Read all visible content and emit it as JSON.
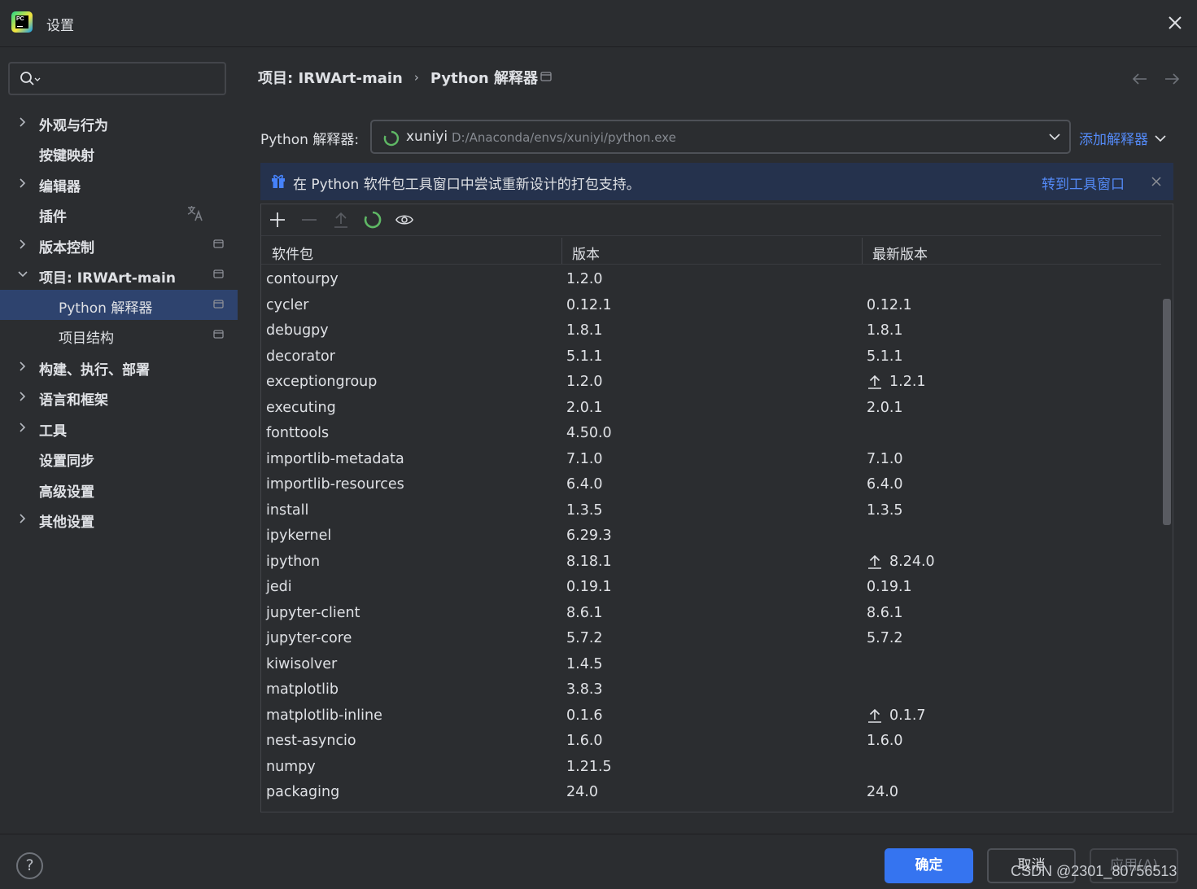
{
  "window": {
    "title": "设置"
  },
  "search": {
    "placeholder": ""
  },
  "sidebar": {
    "items": [
      {
        "label": "外观与行为"
      },
      {
        "label": "按键映射"
      },
      {
        "label": "编辑器"
      },
      {
        "label": "插件"
      },
      {
        "label": "版本控制"
      },
      {
        "label": "项目: IRWArt-main"
      },
      {
        "label": "Python 解释器"
      },
      {
        "label": "项目结构"
      },
      {
        "label": "构建、执行、部署"
      },
      {
        "label": "语言和框架"
      },
      {
        "label": "工具"
      },
      {
        "label": "设置同步"
      },
      {
        "label": "高级设置"
      },
      {
        "label": "其他设置"
      }
    ]
  },
  "breadcrumb": {
    "project": "项目: IRWArt-main",
    "page": "Python 解释器"
  },
  "interpreter": {
    "label": "Python 解释器:",
    "name": "xuniyi",
    "path": "D:/Anaconda/envs/xuniyi/python.exe",
    "add_label": "添加解释器"
  },
  "banner": {
    "message": "在 Python 软件包工具窗口中尝试重新设计的打包支持。",
    "link": "转到工具窗口"
  },
  "table": {
    "headers": [
      "软件包",
      "版本",
      "最新版本"
    ],
    "rows": [
      {
        "name": "contourpy",
        "version": "1.2.0",
        "latest": "",
        "upgrade": false
      },
      {
        "name": "cycler",
        "version": "0.12.1",
        "latest": "0.12.1",
        "upgrade": false
      },
      {
        "name": "debugpy",
        "version": "1.8.1",
        "latest": "1.8.1",
        "upgrade": false
      },
      {
        "name": "decorator",
        "version": "5.1.1",
        "latest": "5.1.1",
        "upgrade": false
      },
      {
        "name": "exceptiongroup",
        "version": "1.2.0",
        "latest": "1.2.1",
        "upgrade": true
      },
      {
        "name": "executing",
        "version": "2.0.1",
        "latest": "2.0.1",
        "upgrade": false
      },
      {
        "name": "fonttools",
        "version": "4.50.0",
        "latest": "",
        "upgrade": false
      },
      {
        "name": "importlib-metadata",
        "version": "7.1.0",
        "latest": "7.1.0",
        "upgrade": false
      },
      {
        "name": "importlib-resources",
        "version": "6.4.0",
        "latest": "6.4.0",
        "upgrade": false
      },
      {
        "name": "install",
        "version": "1.3.5",
        "latest": "1.3.5",
        "upgrade": false
      },
      {
        "name": "ipykernel",
        "version": "6.29.3",
        "latest": "",
        "upgrade": false
      },
      {
        "name": "ipython",
        "version": "8.18.1",
        "latest": "8.24.0",
        "upgrade": true
      },
      {
        "name": "jedi",
        "version": "0.19.1",
        "latest": "0.19.1",
        "upgrade": false
      },
      {
        "name": "jupyter-client",
        "version": "8.6.1",
        "latest": "8.6.1",
        "upgrade": false
      },
      {
        "name": "jupyter-core",
        "version": "5.7.2",
        "latest": "5.7.2",
        "upgrade": false
      },
      {
        "name": "kiwisolver",
        "version": "1.4.5",
        "latest": "",
        "upgrade": false
      },
      {
        "name": "matplotlib",
        "version": "3.8.3",
        "latest": "",
        "upgrade": false
      },
      {
        "name": "matplotlib-inline",
        "version": "0.1.6",
        "latest": "0.1.7",
        "upgrade": true
      },
      {
        "name": "nest-asyncio",
        "version": "1.6.0",
        "latest": "1.6.0",
        "upgrade": false
      },
      {
        "name": "numpy",
        "version": "1.21.5",
        "latest": "",
        "upgrade": false
      },
      {
        "name": "packaging",
        "version": "24.0",
        "latest": "24.0",
        "upgrade": false
      }
    ]
  },
  "footer": {
    "help": "?",
    "ok": "确定",
    "cancel": "取消",
    "apply": "应用(A)"
  },
  "watermark": "CSDN @2301_80756513",
  "colors": {
    "background": "#2b2d30",
    "selected": "#2e436e",
    "link": "#548af7",
    "primary_button": "#3574f0",
    "banner": "#25324d",
    "spinner": "#5fb865"
  }
}
